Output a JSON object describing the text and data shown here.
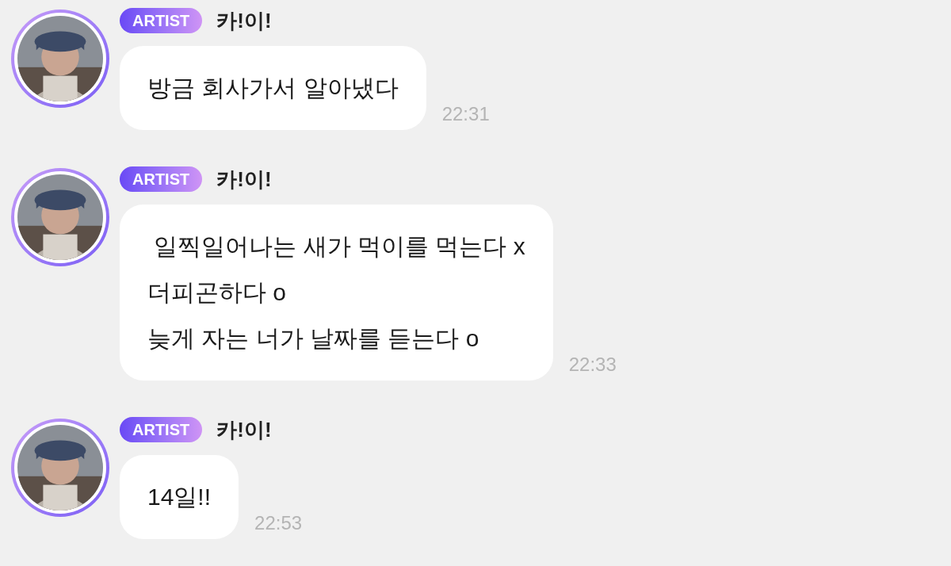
{
  "messages": [
    {
      "badge": "ARTIST",
      "name": "카!이!",
      "text": "방금 회사가서 알아냈다",
      "time": "22:31"
    },
    {
      "badge": "ARTIST",
      "name": "카!이!",
      "text": " 일찍일어나는 새가 먹이를 먹는다 x\n더피곤하다 o\n늦게 자는 너가 날짜를 듣는다 o",
      "time": "22:33"
    },
    {
      "badge": "ARTIST",
      "name": "카!이!",
      "text": "14일!!",
      "time": "22:53"
    }
  ]
}
